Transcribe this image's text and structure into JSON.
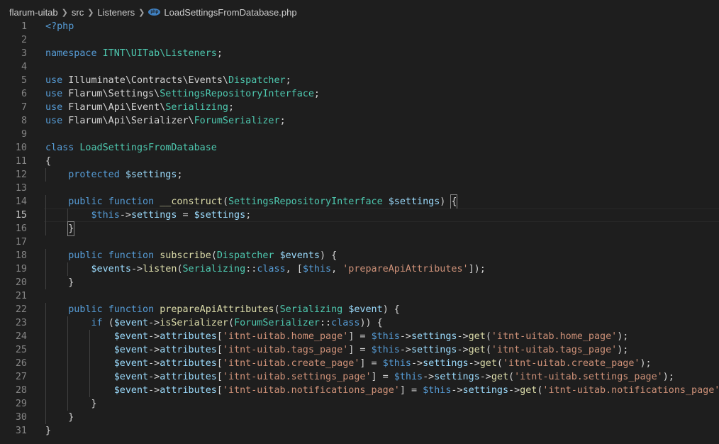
{
  "breadcrumb": {
    "items": [
      "flarum-uitab",
      "src",
      "Listeners",
      "LoadSettingsFromDatabase.php"
    ],
    "file_icon_text": "php"
  },
  "editor": {
    "lines": [
      {
        "num": "1",
        "tokens": [
          [
            "k",
            "<?php"
          ]
        ]
      },
      {
        "num": "2",
        "tokens": []
      },
      {
        "num": "3",
        "tokens": [
          [
            "k",
            "namespace "
          ],
          [
            "t",
            "ITNT\\UITab\\Listeners"
          ],
          [
            "n",
            ";"
          ]
        ]
      },
      {
        "num": "4",
        "tokens": []
      },
      {
        "num": "5",
        "tokens": [
          [
            "k",
            "use "
          ],
          [
            "n",
            "Illuminate\\Contracts\\Events\\"
          ],
          [
            "t",
            "Dispatcher"
          ],
          [
            "n",
            ";"
          ]
        ]
      },
      {
        "num": "6",
        "tokens": [
          [
            "k",
            "use "
          ],
          [
            "n",
            "Flarum\\Settings\\"
          ],
          [
            "t",
            "SettingsRepositoryInterface"
          ],
          [
            "n",
            ";"
          ]
        ]
      },
      {
        "num": "7",
        "tokens": [
          [
            "k",
            "use "
          ],
          [
            "n",
            "Flarum\\Api\\Event\\"
          ],
          [
            "t",
            "Serializing"
          ],
          [
            "n",
            ";"
          ]
        ]
      },
      {
        "num": "8",
        "tokens": [
          [
            "k",
            "use "
          ],
          [
            "n",
            "Flarum\\Api\\Serializer\\"
          ],
          [
            "t",
            "ForumSerializer"
          ],
          [
            "n",
            ";"
          ]
        ]
      },
      {
        "num": "9",
        "tokens": []
      },
      {
        "num": "10",
        "tokens": [
          [
            "k",
            "class "
          ],
          [
            "t",
            "LoadSettingsFromDatabase"
          ]
        ]
      },
      {
        "num": "11",
        "tokens": [
          [
            "n",
            "{"
          ]
        ]
      },
      {
        "num": "12",
        "tokens": [
          [
            "n",
            "    "
          ],
          [
            "k",
            "protected "
          ],
          [
            "v",
            "$settings"
          ],
          [
            "n",
            ";"
          ]
        ]
      },
      {
        "num": "13",
        "tokens": []
      },
      {
        "num": "14",
        "tokens": [
          [
            "n",
            "    "
          ],
          [
            "k",
            "public "
          ],
          [
            "k",
            "function "
          ],
          [
            "f",
            "__construct"
          ],
          [
            "n",
            "("
          ],
          [
            "t",
            "SettingsRepositoryInterface"
          ],
          [
            "n",
            " "
          ],
          [
            "v",
            "$settings"
          ],
          [
            "n",
            ") "
          ],
          [
            "B",
            "{"
          ]
        ]
      },
      {
        "num": "15",
        "active": true,
        "tokens": [
          [
            "n",
            "        "
          ],
          [
            "k",
            "$this"
          ],
          [
            "n",
            "->"
          ],
          [
            "v",
            "settings"
          ],
          [
            "n",
            " = "
          ],
          [
            "v",
            "$settings"
          ],
          [
            "n",
            ";"
          ]
        ]
      },
      {
        "num": "16",
        "tokens": [
          [
            "n",
            "    "
          ],
          [
            "B",
            "}"
          ]
        ]
      },
      {
        "num": "17",
        "tokens": []
      },
      {
        "num": "18",
        "tokens": [
          [
            "n",
            "    "
          ],
          [
            "k",
            "public "
          ],
          [
            "k",
            "function "
          ],
          [
            "f",
            "subscribe"
          ],
          [
            "n",
            "("
          ],
          [
            "t",
            "Dispatcher"
          ],
          [
            "n",
            " "
          ],
          [
            "v",
            "$events"
          ],
          [
            "n",
            ") {"
          ]
        ]
      },
      {
        "num": "19",
        "tokens": [
          [
            "n",
            "        "
          ],
          [
            "v",
            "$events"
          ],
          [
            "n",
            "->"
          ],
          [
            "f",
            "listen"
          ],
          [
            "n",
            "("
          ],
          [
            "t",
            "Serializing"
          ],
          [
            "n",
            "::"
          ],
          [
            "k",
            "class"
          ],
          [
            "n",
            ", ["
          ],
          [
            "k",
            "$this"
          ],
          [
            "n",
            ", "
          ],
          [
            "s",
            "'prepareApiAttributes'"
          ],
          [
            "n",
            "]);"
          ]
        ]
      },
      {
        "num": "20",
        "tokens": [
          [
            "n",
            "    }"
          ]
        ]
      },
      {
        "num": "21",
        "tokens": []
      },
      {
        "num": "22",
        "tokens": [
          [
            "n",
            "    "
          ],
          [
            "k",
            "public "
          ],
          [
            "k",
            "function "
          ],
          [
            "f",
            "prepareApiAttributes"
          ],
          [
            "n",
            "("
          ],
          [
            "t",
            "Serializing"
          ],
          [
            "n",
            " "
          ],
          [
            "v",
            "$event"
          ],
          [
            "n",
            ") {"
          ]
        ]
      },
      {
        "num": "23",
        "tokens": [
          [
            "n",
            "        "
          ],
          [
            "k",
            "if "
          ],
          [
            "n",
            "("
          ],
          [
            "v",
            "$event"
          ],
          [
            "n",
            "->"
          ],
          [
            "f",
            "isSerializer"
          ],
          [
            "n",
            "("
          ],
          [
            "t",
            "ForumSerializer"
          ],
          [
            "n",
            "::"
          ],
          [
            "k",
            "class"
          ],
          [
            "n",
            ")) {"
          ]
        ]
      },
      {
        "num": "24",
        "tokens": [
          [
            "n",
            "            "
          ],
          [
            "v",
            "$event"
          ],
          [
            "n",
            "->"
          ],
          [
            "v",
            "attributes"
          ],
          [
            "n",
            "["
          ],
          [
            "s",
            "'itnt-uitab.home_page'"
          ],
          [
            "n",
            "] = "
          ],
          [
            "k",
            "$this"
          ],
          [
            "n",
            "->"
          ],
          [
            "v",
            "settings"
          ],
          [
            "n",
            "->"
          ],
          [
            "f",
            "get"
          ],
          [
            "n",
            "("
          ],
          [
            "s",
            "'itnt-uitab.home_page'"
          ],
          [
            "n",
            ");"
          ]
        ]
      },
      {
        "num": "25",
        "tokens": [
          [
            "n",
            "            "
          ],
          [
            "v",
            "$event"
          ],
          [
            "n",
            "->"
          ],
          [
            "v",
            "attributes"
          ],
          [
            "n",
            "["
          ],
          [
            "s",
            "'itnt-uitab.tags_page'"
          ],
          [
            "n",
            "] = "
          ],
          [
            "k",
            "$this"
          ],
          [
            "n",
            "->"
          ],
          [
            "v",
            "settings"
          ],
          [
            "n",
            "->"
          ],
          [
            "f",
            "get"
          ],
          [
            "n",
            "("
          ],
          [
            "s",
            "'itnt-uitab.tags_page'"
          ],
          [
            "n",
            ");"
          ]
        ]
      },
      {
        "num": "26",
        "tokens": [
          [
            "n",
            "            "
          ],
          [
            "v",
            "$event"
          ],
          [
            "n",
            "->"
          ],
          [
            "v",
            "attributes"
          ],
          [
            "n",
            "["
          ],
          [
            "s",
            "'itnt-uitab.create_page'"
          ],
          [
            "n",
            "] = "
          ],
          [
            "k",
            "$this"
          ],
          [
            "n",
            "->"
          ],
          [
            "v",
            "settings"
          ],
          [
            "n",
            "->"
          ],
          [
            "f",
            "get"
          ],
          [
            "n",
            "("
          ],
          [
            "s",
            "'itnt-uitab.create_page'"
          ],
          [
            "n",
            ");"
          ]
        ]
      },
      {
        "num": "27",
        "tokens": [
          [
            "n",
            "            "
          ],
          [
            "v",
            "$event"
          ],
          [
            "n",
            "->"
          ],
          [
            "v",
            "attributes"
          ],
          [
            "n",
            "["
          ],
          [
            "s",
            "'itnt-uitab.settings_page'"
          ],
          [
            "n",
            "] = "
          ],
          [
            "k",
            "$this"
          ],
          [
            "n",
            "->"
          ],
          [
            "v",
            "settings"
          ],
          [
            "n",
            "->"
          ],
          [
            "f",
            "get"
          ],
          [
            "n",
            "("
          ],
          [
            "s",
            "'itnt-uitab.settings_page'"
          ],
          [
            "n",
            ");"
          ]
        ]
      },
      {
        "num": "28",
        "tokens": [
          [
            "n",
            "            "
          ],
          [
            "v",
            "$event"
          ],
          [
            "n",
            "->"
          ],
          [
            "v",
            "attributes"
          ],
          [
            "n",
            "["
          ],
          [
            "s",
            "'itnt-uitab.notifications_page'"
          ],
          [
            "n",
            "] = "
          ],
          [
            "k",
            "$this"
          ],
          [
            "n",
            "->"
          ],
          [
            "v",
            "settings"
          ],
          [
            "n",
            "->"
          ],
          [
            "f",
            "get"
          ],
          [
            "n",
            "("
          ],
          [
            "s",
            "'itnt-uitab.notifications_page'"
          ],
          [
            "n",
            ");"
          ]
        ]
      },
      {
        "num": "29",
        "tokens": [
          [
            "n",
            "        }"
          ]
        ]
      },
      {
        "num": "30",
        "tokens": [
          [
            "n",
            "    }"
          ]
        ]
      },
      {
        "num": "31",
        "tokens": [
          [
            "n",
            "}"
          ]
        ]
      }
    ]
  },
  "colors": {
    "background": "#1e1e1e",
    "keyword": "#569cd6",
    "type": "#4ec9b0",
    "function": "#dcdcaa",
    "variable": "#9cdcfe",
    "string": "#ce9178",
    "default": "#d4d4d4",
    "line_number": "#858585"
  }
}
